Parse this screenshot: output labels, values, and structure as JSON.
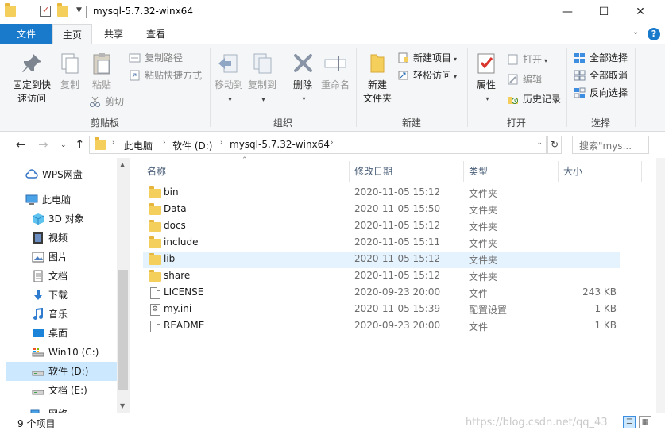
{
  "window": {
    "title": "mysql-5.7.32-winx64",
    "minimize": "—",
    "maximize": "☐",
    "close": "✕"
  },
  "tabs": {
    "file": "文件",
    "home": "主页",
    "share": "共享",
    "view": "查看"
  },
  "ribbon": {
    "clipboard": {
      "label": "剪贴板",
      "pin": "固定到快速访问",
      "pin_line1": "固定到快",
      "pin_line2": "速访问",
      "copy": "复制",
      "paste": "粘贴",
      "copy_path": "复制路径",
      "paste_shortcut": "粘贴快捷方式",
      "cut": "剪切"
    },
    "organize": {
      "label": "组织",
      "move_to": "移动到",
      "copy_to": "复制到",
      "delete": "删除",
      "rename": "重命名"
    },
    "new": {
      "label": "新建",
      "new_folder_line1": "新建",
      "new_folder_line2": "文件夹",
      "new_item": "新建项目",
      "easy_access": "轻松访问"
    },
    "open": {
      "label": "打开",
      "properties": "属性",
      "open": "打开",
      "edit": "编辑",
      "history": "历史记录"
    },
    "select": {
      "label": "选择",
      "select_all": "全部选择",
      "select_none": "全部取消",
      "invert": "反向选择"
    }
  },
  "address": {
    "crumbs": [
      "此电脑",
      "软件 (D:)",
      "mysql-5.7.32-winx64"
    ],
    "search_placeholder": "搜索\"mys..."
  },
  "nav": {
    "items": [
      {
        "label": "WPS网盘",
        "icon": "cloud-icon"
      },
      {
        "label": "此电脑",
        "icon": "computer-icon"
      },
      {
        "label": "3D 对象",
        "icon": "cube-icon"
      },
      {
        "label": "视频",
        "icon": "video-icon"
      },
      {
        "label": "图片",
        "icon": "picture-icon"
      },
      {
        "label": "文档",
        "icon": "document-icon"
      },
      {
        "label": "下载",
        "icon": "download-icon"
      },
      {
        "label": "音乐",
        "icon": "music-icon"
      },
      {
        "label": "桌面",
        "icon": "desktop-icon"
      },
      {
        "label": "Win10 (C:)",
        "icon": "system-drive-icon"
      },
      {
        "label": "软件 (D:)",
        "icon": "drive-icon"
      },
      {
        "label": "文档 (E:)",
        "icon": "drive-icon"
      },
      {
        "label": "网络",
        "icon": "network-icon"
      }
    ]
  },
  "columns": {
    "name": "名称",
    "date": "修改日期",
    "type": "类型",
    "size": "大小"
  },
  "files": [
    {
      "name": "bin",
      "date": "2020-11-05 15:12",
      "type": "文件夹",
      "size": ""
    },
    {
      "name": "Data",
      "date": "2020-11-05 15:50",
      "type": "文件夹",
      "size": ""
    },
    {
      "name": "docs",
      "date": "2020-11-05 15:12",
      "type": "文件夹",
      "size": ""
    },
    {
      "name": "include",
      "date": "2020-11-05 15:11",
      "type": "文件夹",
      "size": ""
    },
    {
      "name": "lib",
      "date": "2020-11-05 15:12",
      "type": "文件夹",
      "size": ""
    },
    {
      "name": "share",
      "date": "2020-11-05 15:12",
      "type": "文件夹",
      "size": ""
    },
    {
      "name": "LICENSE",
      "date": "2020-09-23 20:00",
      "type": "文件",
      "size": "243 KB"
    },
    {
      "name": "my.ini",
      "date": "2020-11-05 15:39",
      "type": "配置设置",
      "size": "1 KB"
    },
    {
      "name": "README",
      "date": "2020-09-23 20:00",
      "type": "文件",
      "size": "1 KB"
    }
  ],
  "status": {
    "count": "9 个项目",
    "watermark": "https://blog.csdn.net/qq_43"
  }
}
